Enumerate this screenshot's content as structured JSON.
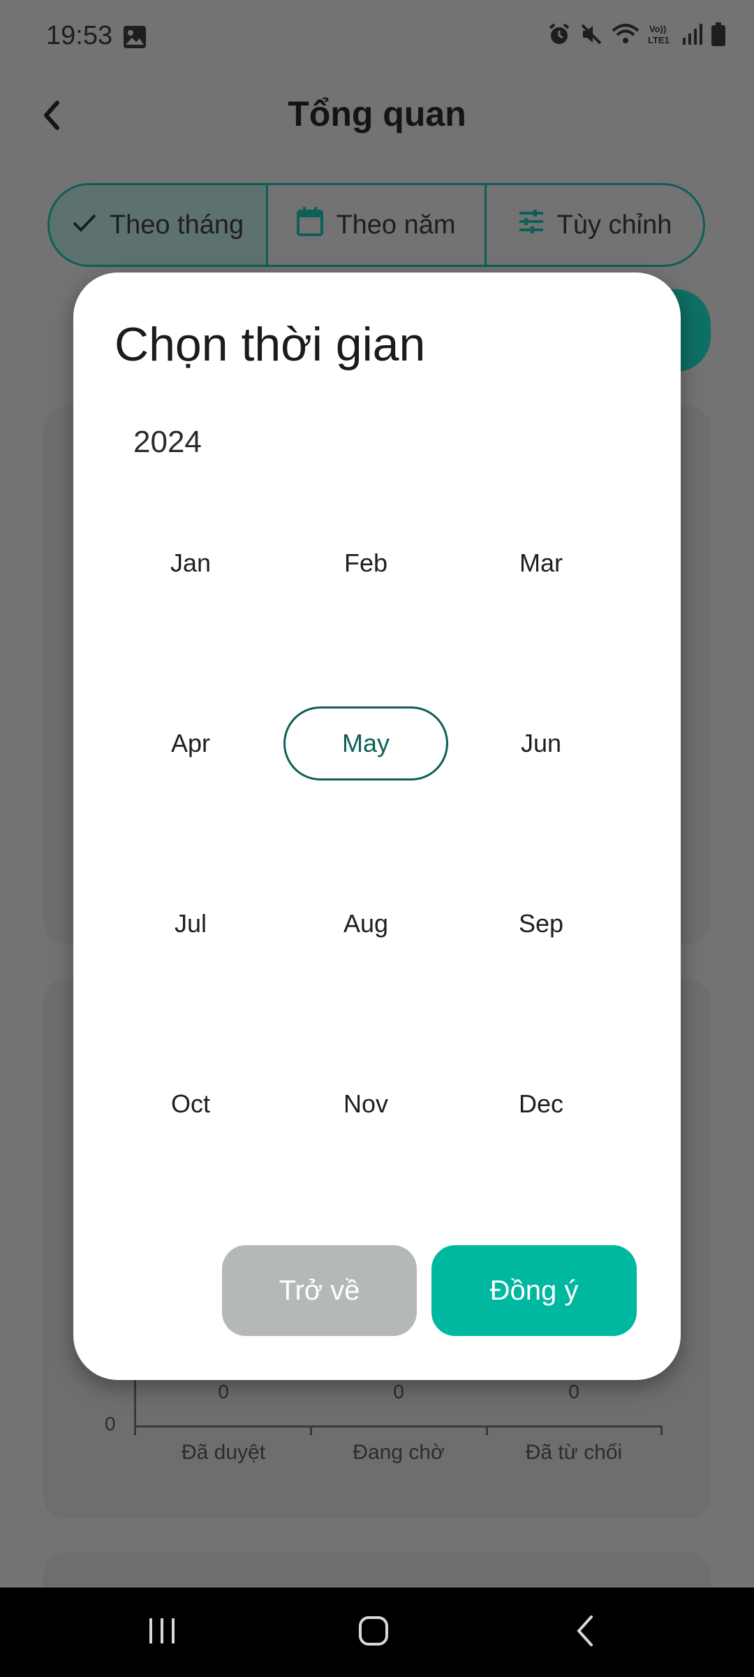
{
  "status_bar": {
    "time": "19:53",
    "icons": [
      "gallery-icon",
      "alarm-icon",
      "mute-icon",
      "wifi-icon",
      "volte-icon",
      "signal-icon",
      "battery-icon"
    ],
    "volte_label": "Vo))\nLTE1"
  },
  "header": {
    "title": "Tổng quan",
    "back_icon": "chevron-left-icon"
  },
  "filter_tabs": [
    {
      "label": "Theo tháng",
      "icon": "check-icon",
      "selected": true
    },
    {
      "label": "Theo năm",
      "icon": "calendar-icon",
      "selected": false
    },
    {
      "label": "Tùy chỉnh",
      "icon": "sliders-icon",
      "selected": false
    }
  ],
  "background_chart": {
    "y_zero": "0",
    "bars": [
      {
        "label": "Đã duyệt",
        "value": "0"
      },
      {
        "label": "Đang chờ",
        "value": "0"
      },
      {
        "label": "Đã từ chối",
        "value": "0"
      }
    ]
  },
  "dialog": {
    "title": "Chọn thời gian",
    "year": "2024",
    "months": [
      "Jan",
      "Feb",
      "Mar",
      "Apr",
      "May",
      "Jun",
      "Jul",
      "Aug",
      "Sep",
      "Oct",
      "Nov",
      "Dec"
    ],
    "selected_month": "May",
    "cancel_label": "Trở về",
    "ok_label": "Đồng ý"
  },
  "colors": {
    "accent": "#00b8a0",
    "accent_dark": "#0d5f58",
    "cancel_gray": "#b4b9b8",
    "scrim": "#737373"
  }
}
